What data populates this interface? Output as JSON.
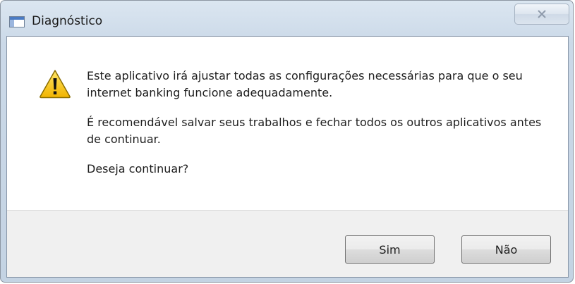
{
  "window": {
    "title": "Diagnóstico",
    "icon": "application-window-icon"
  },
  "title_bar_buttons": {
    "close_icon": "close-icon"
  },
  "dialog": {
    "icon": "warning-icon",
    "paragraphs": [
      "Este aplicativo irá ajustar todas as configurações necessárias para que o seu internet banking funcione adequadamente.",
      "É recomendável salvar seus trabalhos e fechar todos os outros aplicativos antes de continuar.",
      "Deseja continuar?"
    ]
  },
  "buttons": {
    "yes_label": "Sim",
    "no_label": "Não"
  },
  "colors": {
    "frame": "#cbd9e8",
    "warning_fill": "#f7c600",
    "warning_stroke": "#8a6d00",
    "button_bar": "#f0f0f0"
  }
}
